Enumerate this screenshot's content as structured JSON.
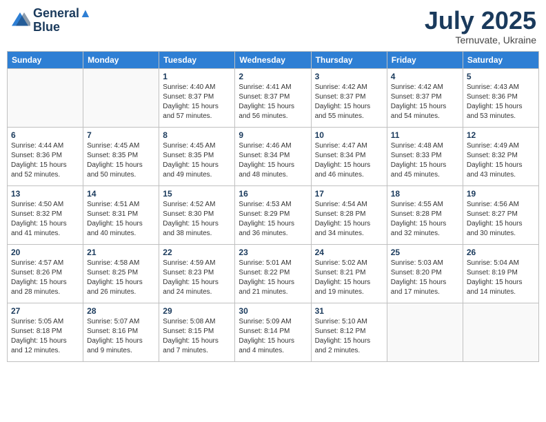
{
  "logo": {
    "line1": "General",
    "line2": "Blue"
  },
  "title": "July 2025",
  "subtitle": "Ternuvate, Ukraine",
  "days_of_week": [
    "Sunday",
    "Monday",
    "Tuesday",
    "Wednesday",
    "Thursday",
    "Friday",
    "Saturday"
  ],
  "weeks": [
    [
      {
        "day": "",
        "empty": true
      },
      {
        "day": "",
        "empty": true
      },
      {
        "day": "1",
        "sunrise": "4:40 AM",
        "sunset": "8:37 PM",
        "daylight": "15 hours and 57 minutes."
      },
      {
        "day": "2",
        "sunrise": "4:41 AM",
        "sunset": "8:37 PM",
        "daylight": "15 hours and 56 minutes."
      },
      {
        "day": "3",
        "sunrise": "4:42 AM",
        "sunset": "8:37 PM",
        "daylight": "15 hours and 55 minutes."
      },
      {
        "day": "4",
        "sunrise": "4:42 AM",
        "sunset": "8:37 PM",
        "daylight": "15 hours and 54 minutes."
      },
      {
        "day": "5",
        "sunrise": "4:43 AM",
        "sunset": "8:36 PM",
        "daylight": "15 hours and 53 minutes."
      }
    ],
    [
      {
        "day": "6",
        "sunrise": "4:44 AM",
        "sunset": "8:36 PM",
        "daylight": "15 hours and 52 minutes."
      },
      {
        "day": "7",
        "sunrise": "4:45 AM",
        "sunset": "8:35 PM",
        "daylight": "15 hours and 50 minutes."
      },
      {
        "day": "8",
        "sunrise": "4:45 AM",
        "sunset": "8:35 PM",
        "daylight": "15 hours and 49 minutes."
      },
      {
        "day": "9",
        "sunrise": "4:46 AM",
        "sunset": "8:34 PM",
        "daylight": "15 hours and 48 minutes."
      },
      {
        "day": "10",
        "sunrise": "4:47 AM",
        "sunset": "8:34 PM",
        "daylight": "15 hours and 46 minutes."
      },
      {
        "day": "11",
        "sunrise": "4:48 AM",
        "sunset": "8:33 PM",
        "daylight": "15 hours and 45 minutes."
      },
      {
        "day": "12",
        "sunrise": "4:49 AM",
        "sunset": "8:32 PM",
        "daylight": "15 hours and 43 minutes."
      }
    ],
    [
      {
        "day": "13",
        "sunrise": "4:50 AM",
        "sunset": "8:32 PM",
        "daylight": "15 hours and 41 minutes."
      },
      {
        "day": "14",
        "sunrise": "4:51 AM",
        "sunset": "8:31 PM",
        "daylight": "15 hours and 40 minutes."
      },
      {
        "day": "15",
        "sunrise": "4:52 AM",
        "sunset": "8:30 PM",
        "daylight": "15 hours and 38 minutes."
      },
      {
        "day": "16",
        "sunrise": "4:53 AM",
        "sunset": "8:29 PM",
        "daylight": "15 hours and 36 minutes."
      },
      {
        "day": "17",
        "sunrise": "4:54 AM",
        "sunset": "8:28 PM",
        "daylight": "15 hours and 34 minutes."
      },
      {
        "day": "18",
        "sunrise": "4:55 AM",
        "sunset": "8:28 PM",
        "daylight": "15 hours and 32 minutes."
      },
      {
        "day": "19",
        "sunrise": "4:56 AM",
        "sunset": "8:27 PM",
        "daylight": "15 hours and 30 minutes."
      }
    ],
    [
      {
        "day": "20",
        "sunrise": "4:57 AM",
        "sunset": "8:26 PM",
        "daylight": "15 hours and 28 minutes."
      },
      {
        "day": "21",
        "sunrise": "4:58 AM",
        "sunset": "8:25 PM",
        "daylight": "15 hours and 26 minutes."
      },
      {
        "day": "22",
        "sunrise": "4:59 AM",
        "sunset": "8:23 PM",
        "daylight": "15 hours and 24 minutes."
      },
      {
        "day": "23",
        "sunrise": "5:01 AM",
        "sunset": "8:22 PM",
        "daylight": "15 hours and 21 minutes."
      },
      {
        "day": "24",
        "sunrise": "5:02 AM",
        "sunset": "8:21 PM",
        "daylight": "15 hours and 19 minutes."
      },
      {
        "day": "25",
        "sunrise": "5:03 AM",
        "sunset": "8:20 PM",
        "daylight": "15 hours and 17 minutes."
      },
      {
        "day": "26",
        "sunrise": "5:04 AM",
        "sunset": "8:19 PM",
        "daylight": "15 hours and 14 minutes."
      }
    ],
    [
      {
        "day": "27",
        "sunrise": "5:05 AM",
        "sunset": "8:18 PM",
        "daylight": "15 hours and 12 minutes."
      },
      {
        "day": "28",
        "sunrise": "5:07 AM",
        "sunset": "8:16 PM",
        "daylight": "15 hours and 9 minutes."
      },
      {
        "day": "29",
        "sunrise": "5:08 AM",
        "sunset": "8:15 PM",
        "daylight": "15 hours and 7 minutes."
      },
      {
        "day": "30",
        "sunrise": "5:09 AM",
        "sunset": "8:14 PM",
        "daylight": "15 hours and 4 minutes."
      },
      {
        "day": "31",
        "sunrise": "5:10 AM",
        "sunset": "8:12 PM",
        "daylight": "15 hours and 2 minutes."
      },
      {
        "day": "",
        "empty": true
      },
      {
        "day": "",
        "empty": true
      }
    ]
  ]
}
